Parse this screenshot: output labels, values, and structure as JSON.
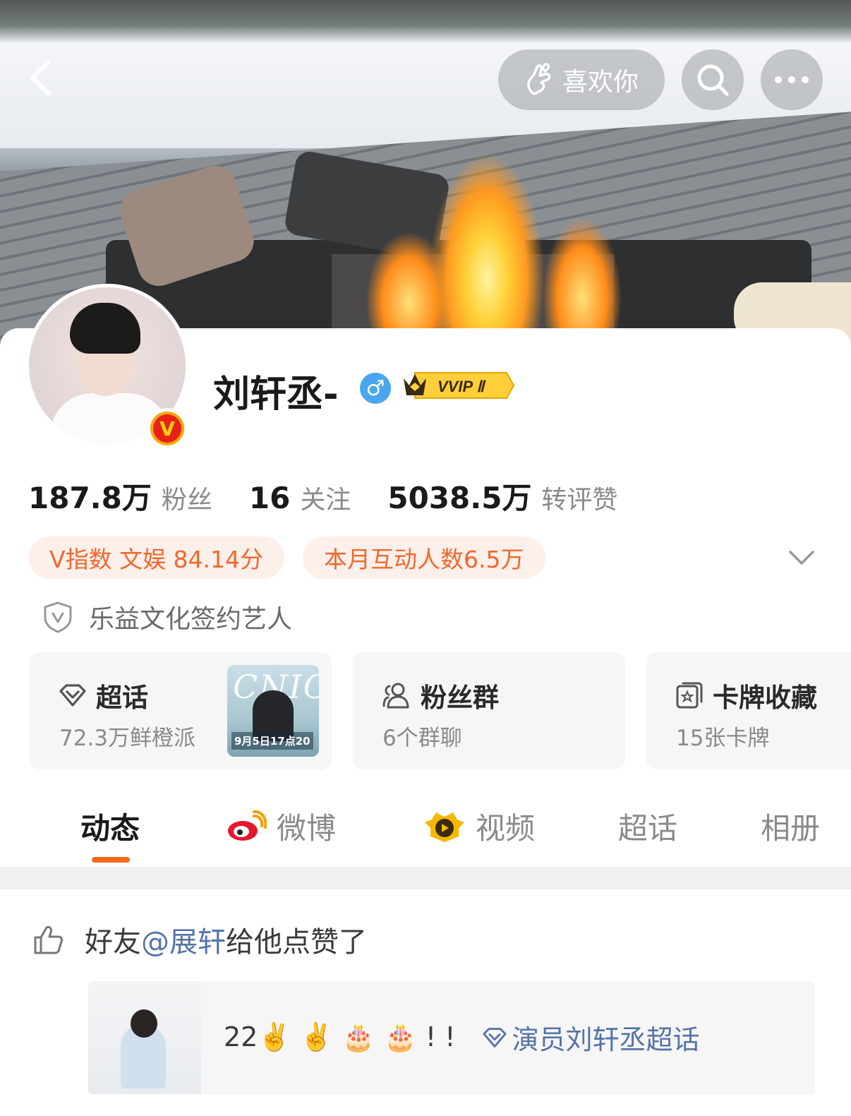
{
  "header": {
    "like_label": "喜欢你"
  },
  "profile": {
    "name": "刘轩丞-",
    "gender_symbol": "♂",
    "vip_label": "VVIP Ⅱ",
    "verified_badge": "V"
  },
  "stats": [
    {
      "value": "187.8万",
      "label": "粉丝"
    },
    {
      "value": "16",
      "label": "关注"
    },
    {
      "value": "5038.5万",
      "label": "转评赞"
    }
  ],
  "tags": [
    "V指数 文娱 84.14分",
    "本月互动人数6.5万"
  ],
  "company": "乐益文化签约艺人",
  "tiles": {
    "chaohua": {
      "title": "超话",
      "sub": "72.3万鲜橙派",
      "poster_title": "CNIC",
      "poster_date": "9月5日17点20"
    },
    "fans": {
      "title": "粉丝群",
      "sub": "6个群聊"
    },
    "cards": {
      "title": "卡牌收藏",
      "sub": "15张卡牌"
    }
  },
  "tabs": [
    "动态",
    "微博",
    "视频",
    "超话",
    "相册"
  ],
  "feed": {
    "liked_prefix": "好友",
    "liked_mention": "@展轩",
    "liked_suffix": "给他点赞了",
    "post_text": "22✌️ ✌️ 🎂 🎂 ! !",
    "post_topic": "演员刘轩丞超话"
  },
  "colors": {
    "accent": "#f26b1d",
    "tag_text": "#f0682d",
    "tag_bg": "#fdf0ea",
    "link": "#5574a8"
  }
}
